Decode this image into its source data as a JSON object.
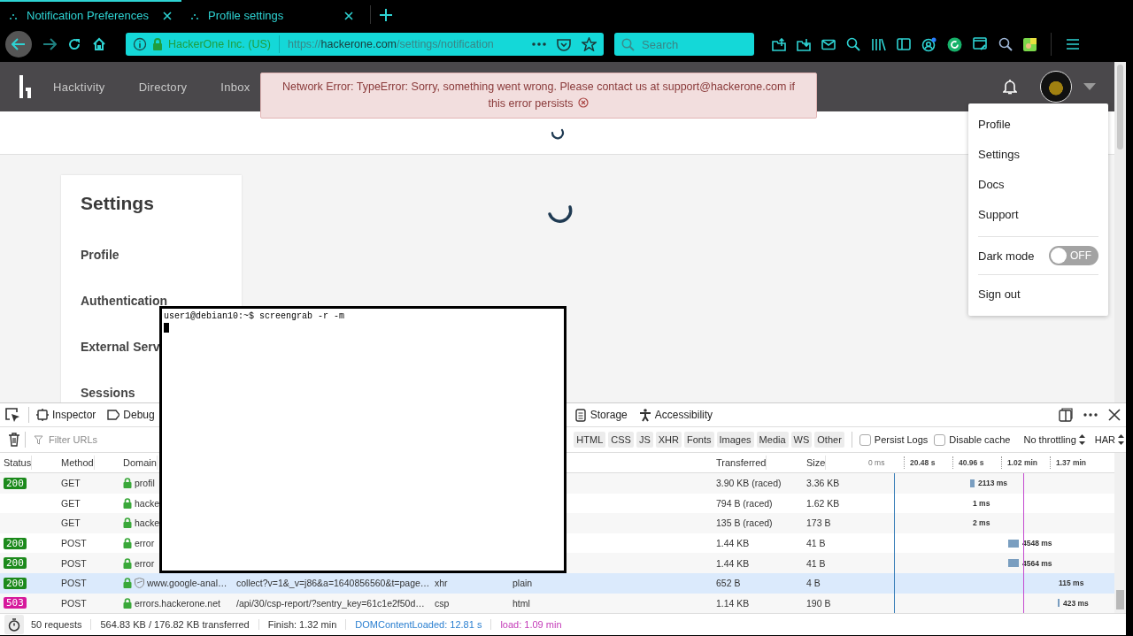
{
  "browser": {
    "tabs": [
      {
        "title": "Notification Preferences",
        "selected": true
      },
      {
        "title": "Profile settings",
        "selected": false
      }
    ],
    "address": {
      "identity": "HackerOne Inc. (US)",
      "scheme": "https://",
      "host": "hackerone.com",
      "path": "/settings/notification"
    },
    "search": {
      "placeholder": "Search"
    }
  },
  "site": {
    "nav": [
      "Hacktivity",
      "Directory",
      "Inbox"
    ],
    "error": "Network Error: TypeError: Sorry, something went wrong. Please contact us at support@hackerone.com if this error persists",
    "settings": {
      "title": "Settings",
      "items": [
        "Profile",
        "Authentication",
        "External Serv",
        "Sessions"
      ]
    },
    "user_menu": {
      "items": [
        "Profile",
        "Settings",
        "Docs",
        "Support"
      ],
      "dark_mode": {
        "label": "Dark mode",
        "on": false,
        "state_text": "OFF"
      },
      "sign_out": "Sign out"
    }
  },
  "terminal": {
    "lines": [
      "user1@debian10:~$ screengrab -r -m"
    ]
  },
  "devtools": {
    "tabs": [
      "Inspector",
      "Debug",
      "Storage",
      "Accessibility"
    ],
    "filter": {
      "placeholder": "Filter URLs"
    },
    "type_filters": [
      "HTML",
      "CSS",
      "JS",
      "XHR",
      "Fonts",
      "Images",
      "Media",
      "WS",
      "Other"
    ],
    "options": [
      {
        "label": "Persist Logs",
        "checked": false
      },
      {
        "label": "Disable cache",
        "checked": false
      }
    ],
    "throttling": "No throttling",
    "har": "HAR",
    "columns": [
      "Status",
      "Method",
      "Domain",
      "Transferred",
      "Size"
    ],
    "timeline_ticks": [
      "0 ms",
      "20.48 s",
      "40.96 s",
      "1.02 min",
      "1.37 min"
    ],
    "rows": [
      {
        "status": {
          "code": "200",
          "color": "#1c8a1c"
        },
        "method": "GET",
        "domain": "profil",
        "transferred": "3.90 KB (raced)",
        "size": "3.36 KB",
        "timing": "2113 ms",
        "selected": false,
        "tracker": false
      },
      {
        "method": "GET",
        "domain": "hacke",
        "transferred": "794 B (raced)",
        "size": "1.62 KB",
        "timing": "1 ms",
        "selected": false,
        "tracker": false
      },
      {
        "method": "GET",
        "domain": "hacke",
        "transferred": "135 B (raced)",
        "size": "173 B",
        "timing": "2 ms",
        "selected": false,
        "tracker": false
      },
      {
        "status": {
          "code": "200",
          "color": "#1c8a1c"
        },
        "method": "POST",
        "domain": "error",
        "transferred": "1.44 KB",
        "size": "41 B",
        "timing": "4548 ms",
        "selected": false,
        "tracker": false
      },
      {
        "status": {
          "code": "200",
          "color": "#1c8a1c"
        },
        "method": "POST",
        "domain": "error",
        "transferred": "1.44 KB",
        "size": "41 B",
        "timing": "4564 ms",
        "selected": false,
        "tracker": false
      },
      {
        "status": {
          "code": "200",
          "color": "#1c8a1c"
        },
        "method": "POST",
        "domain": "www.google-anal…",
        "file": "collect?v=1&_v=j86&a=1640856560&t=page…",
        "cause": "xhr",
        "type": "plain",
        "transferred": "652 B",
        "size": "4 B",
        "timing": "115 ms",
        "selected": true,
        "tracker": true
      },
      {
        "status": {
          "code": "503",
          "color": "#d6189c"
        },
        "method": "POST",
        "domain": "errors.hackerone.net",
        "file": "/api/30/csp-report/?sentry_key=61c1e2f50d…",
        "cause": "csp",
        "type": "html",
        "transferred": "1.14 KB",
        "size": "190 B",
        "timing": "423 ms",
        "selected": false,
        "tracker": false
      }
    ],
    "summary": {
      "requests": "50 requests",
      "transferred": "564.83 KB / 176.82 KB transferred",
      "finish": "Finish: 1.32 min",
      "dom_content_loaded": "DOMContentLoaded: 12.81 s",
      "load": "load: 1.09 min"
    }
  }
}
